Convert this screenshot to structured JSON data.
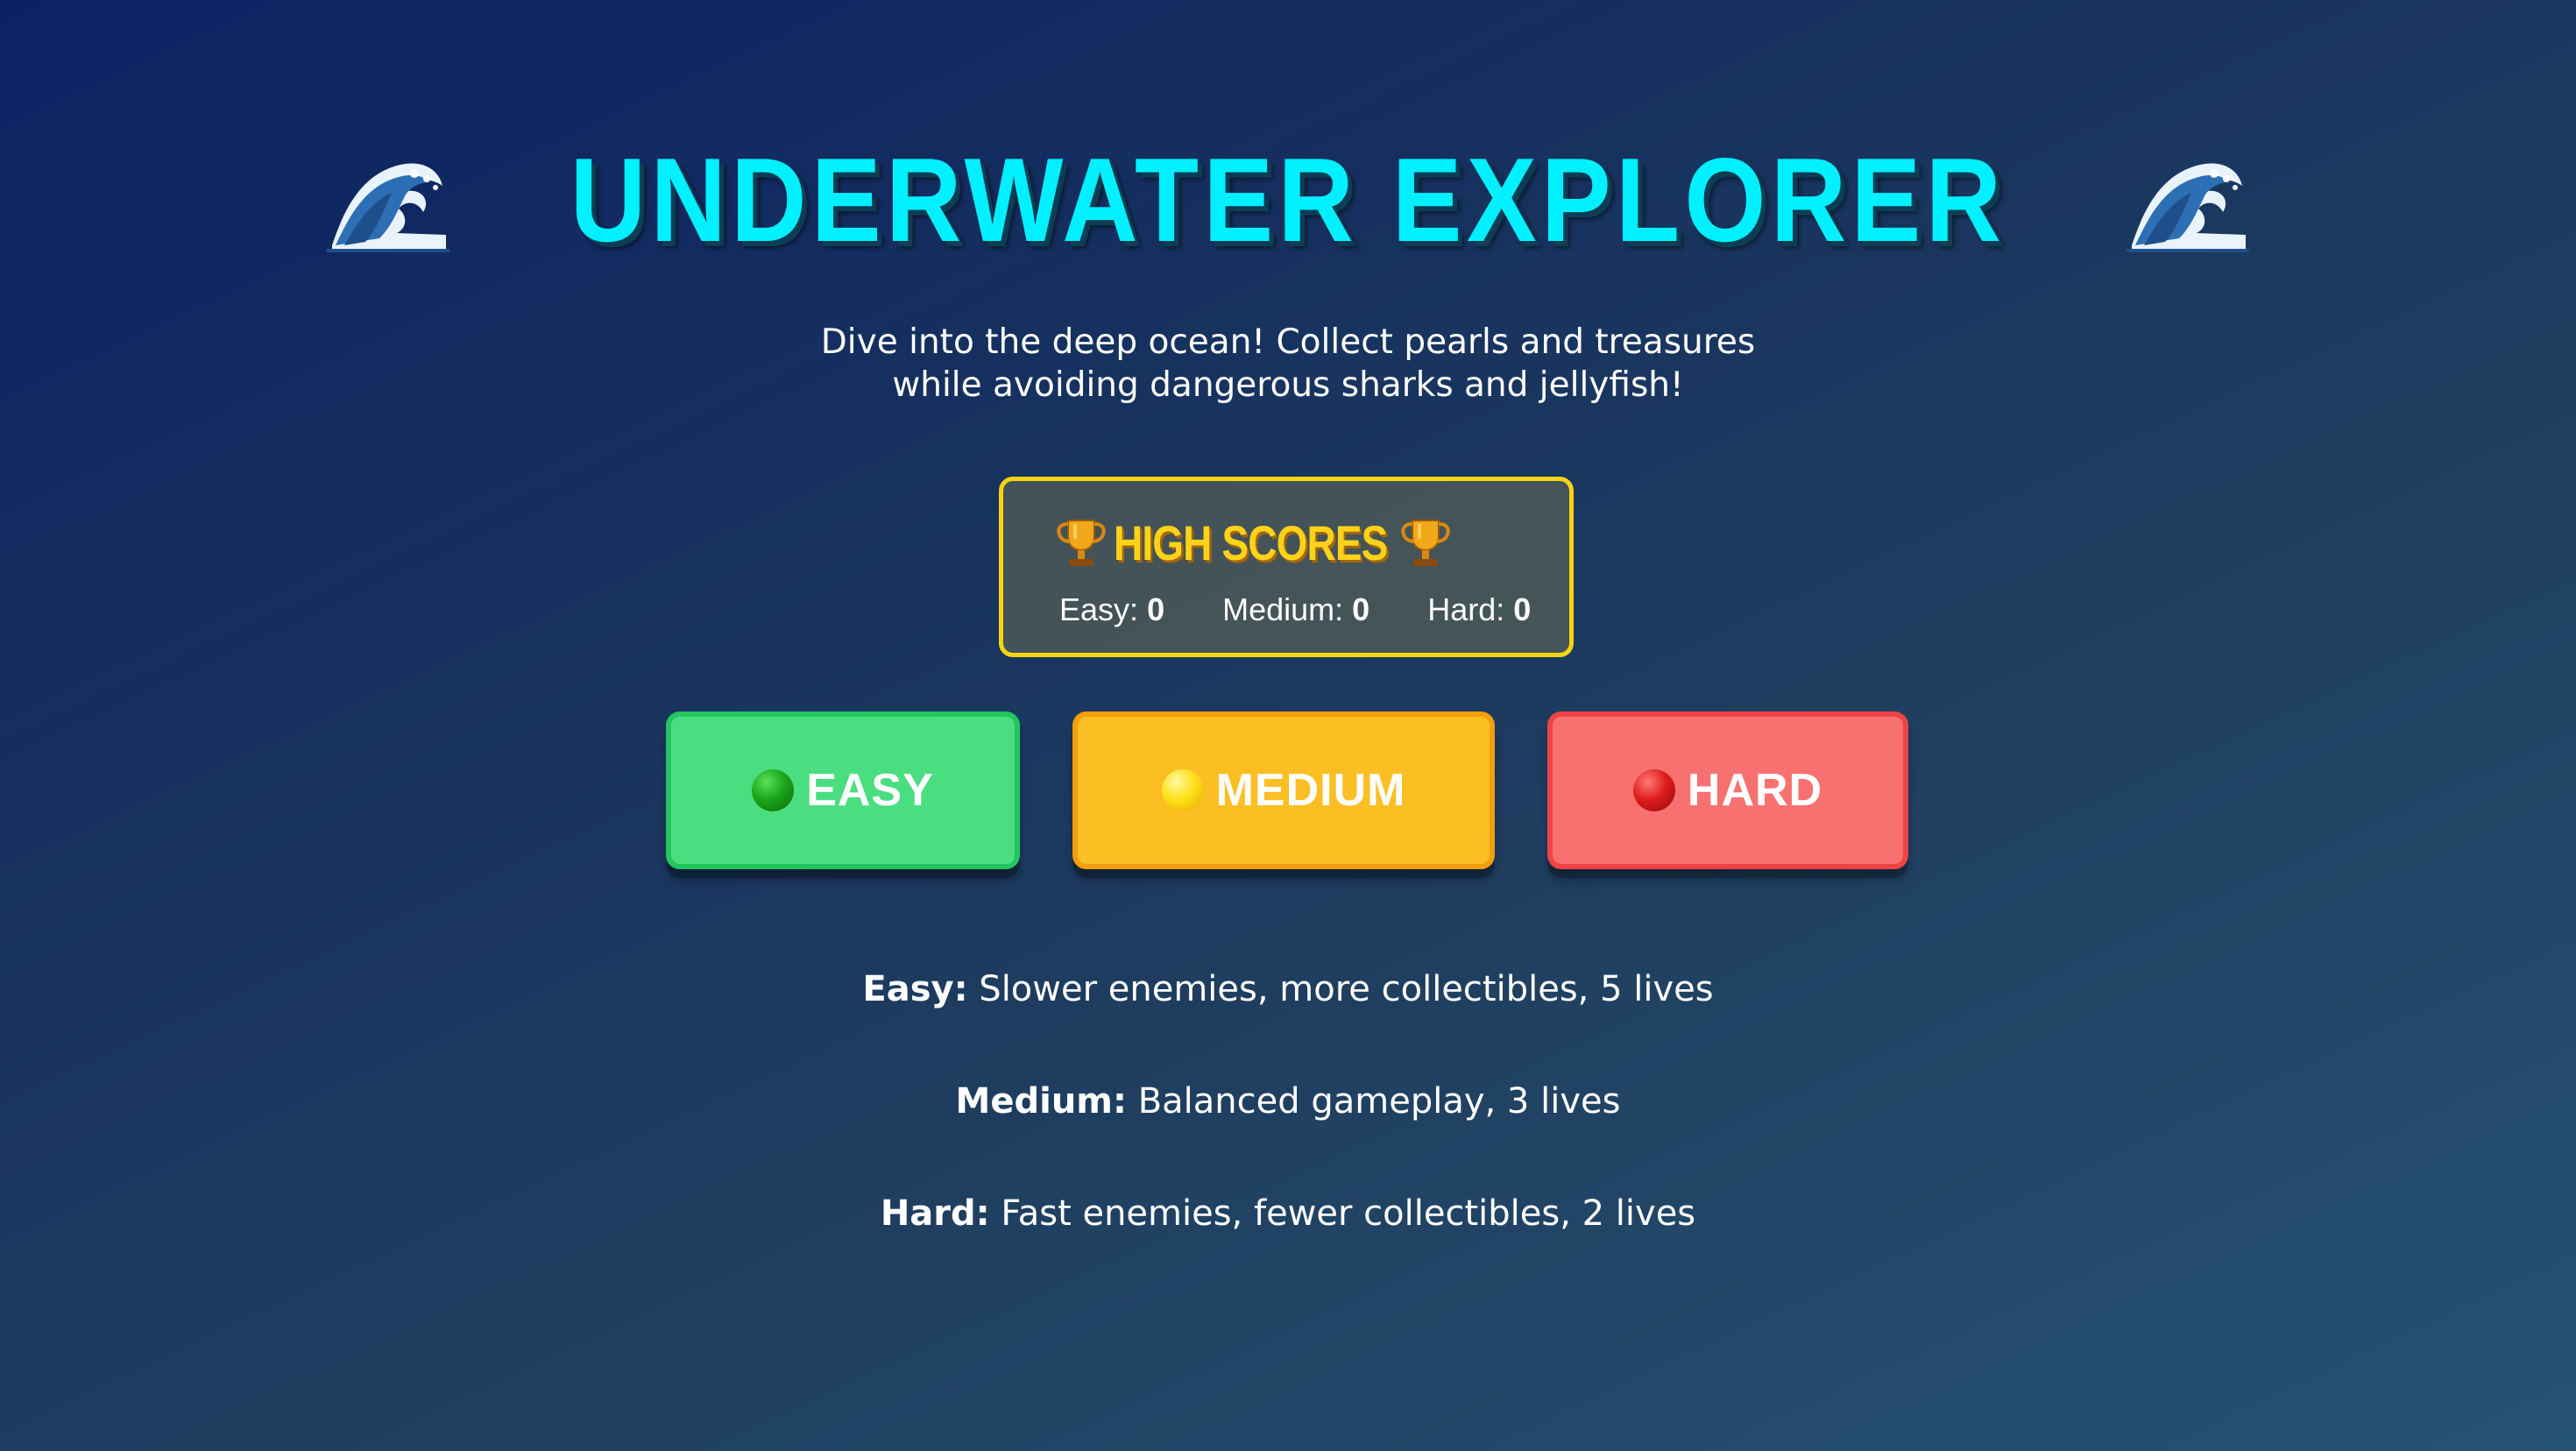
{
  "game": {
    "title": "UNDERWATER EXPLORER",
    "title_icon": "wave-icon",
    "subtitle_line1": "Dive into the deep ocean! Collect pearls and treasures",
    "subtitle_line2": "while avoiding dangerous sharks and jellyfish!"
  },
  "high_scores": {
    "title": "HIGH SCORES",
    "icon": "trophy-icon",
    "entries": [
      {
        "label": "Easy:",
        "value": "0"
      },
      {
        "label": "Medium:",
        "value": "0"
      },
      {
        "label": "Hard:",
        "value": "0"
      }
    ]
  },
  "difficulty": {
    "buttons": [
      {
        "label": "EASY",
        "icon": "green-circle-icon",
        "color": "#4ade80"
      },
      {
        "label": "MEDIUM",
        "icon": "yellow-circle-icon",
        "color": "#fbbf24"
      },
      {
        "label": "HARD",
        "icon": "red-circle-icon",
        "color": "#f87171"
      }
    ],
    "descriptions": [
      {
        "label": "Easy:",
        "text": "Slower enemies, more collectibles, 5 lives"
      },
      {
        "label": "Medium:",
        "text": "Balanced gameplay, 3 lives"
      },
      {
        "label": "Hard:",
        "text": "Fast enemies, fewer collectibles, 2 lives"
      }
    ]
  },
  "colors": {
    "title": "#00f0ff",
    "scores_border": "#f7d411",
    "scores_title": "#ffd21a"
  }
}
